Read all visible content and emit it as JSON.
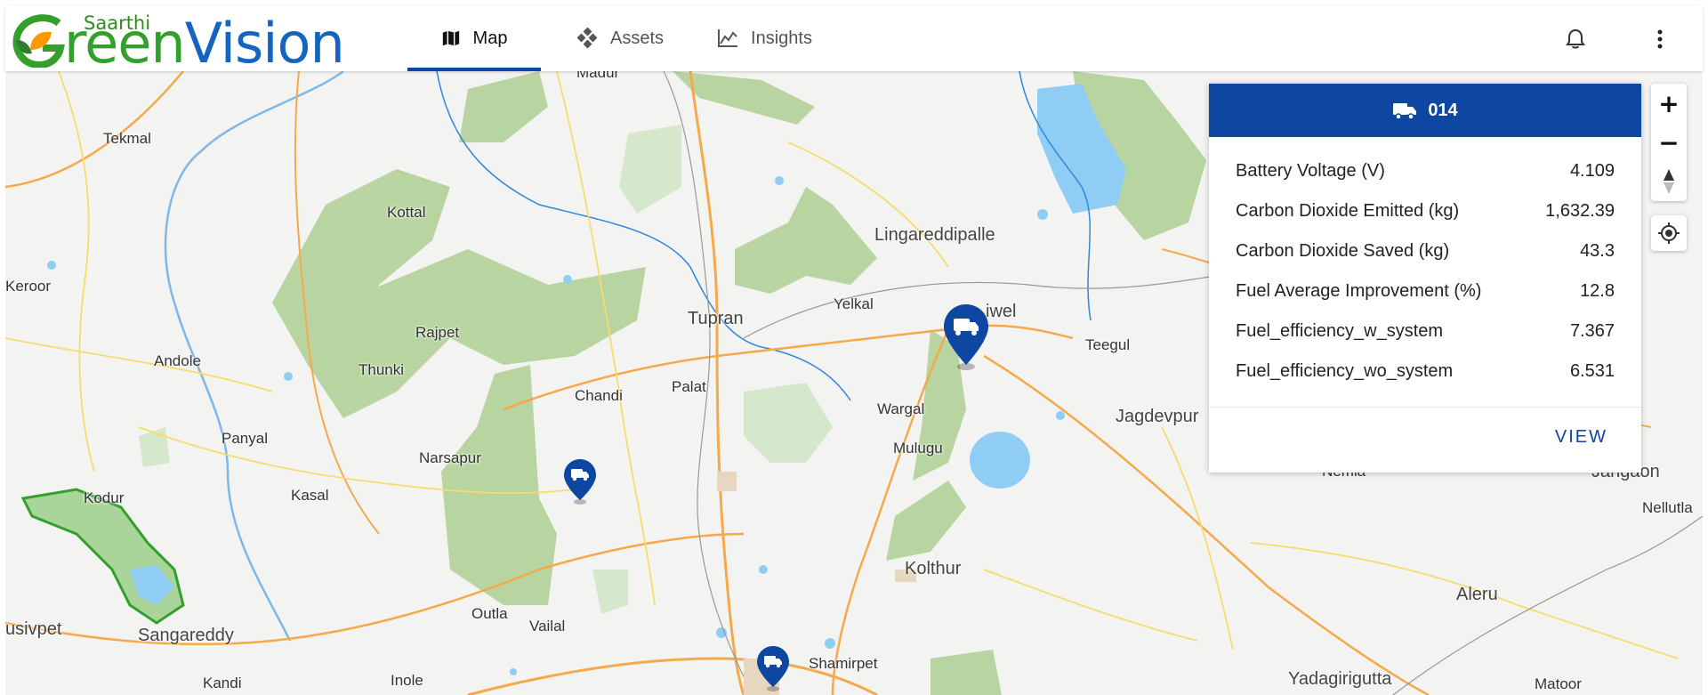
{
  "brand": {
    "small": "Saarthi",
    "green_part": "reen",
    "blue_part": "Vision",
    "colors": {
      "green": "#33a02c",
      "blue": "#1565c0"
    }
  },
  "nav": {
    "tabs": [
      {
        "label": "Map",
        "icon": "map-icon",
        "active": true
      },
      {
        "label": "Assets",
        "icon": "assets-icon",
        "active": false
      },
      {
        "label": "Insights",
        "icon": "insights-chart-icon",
        "active": false
      }
    ],
    "accent": "#0d47a1"
  },
  "header_actions": {
    "notifications_icon": "bell-icon",
    "menu_icon": "more-vertical-icon"
  },
  "map": {
    "places": {
      "madur": "Madur",
      "tekmal": "Tekmal",
      "kottal": "Kottal",
      "keroor": "Keroor",
      "rajpet": "Rajpet",
      "andole": "Andole",
      "thunki": "Thunki",
      "lingareddipalle": "Lingareddipalle",
      "yelkal": "Yelkal",
      "tupran": "Tupran",
      "gajwel": "iwel",
      "teegul": "Teegul",
      "chandi": "Chandi",
      "palat": "Palat",
      "wargal": "Wargal",
      "jagdevpur": "Jagdevpur",
      "panyal": "Panyal",
      "narsapur": "Narsapur",
      "mulugu": "Mulugu",
      "nemla": "Nemla",
      "jangaon": "Jangaon",
      "kodur": "Kodur",
      "kasal": "Kasal",
      "nellutla": "Nellutla",
      "kolthur": "Kolthur",
      "aleru": "Aleru",
      "sivpet": "usivpet",
      "sangareddy": "Sangareddy",
      "outla": "Outla",
      "vailal": "Vailal",
      "shamirpet": "Shamirpet",
      "kandi": "Kandi",
      "inole": "Inole",
      "yadagirigutta": "Yadagirigutta",
      "matoor": "Matoor"
    },
    "controls": {
      "zoom_in": "+",
      "zoom_out": "−",
      "compass_icon": "compass-icon",
      "locate_icon": "locate-icon"
    }
  },
  "popup": {
    "vehicle_id": "014",
    "metrics": [
      {
        "label": "Battery Voltage (V)",
        "value": "4.109"
      },
      {
        "label": "Carbon Dioxide Emitted (kg)",
        "value": "1,632.39"
      },
      {
        "label": "Carbon Dioxide Saved (kg)",
        "value": "43.3"
      },
      {
        "label": "Fuel Average Improvement (%)",
        "value": "12.8"
      },
      {
        "label": "Fuel_efficiency_w_system",
        "value": "7.367"
      },
      {
        "label": "Fuel_efficiency_wo_system",
        "value": "6.531"
      }
    ],
    "view_label": "VIEW"
  }
}
